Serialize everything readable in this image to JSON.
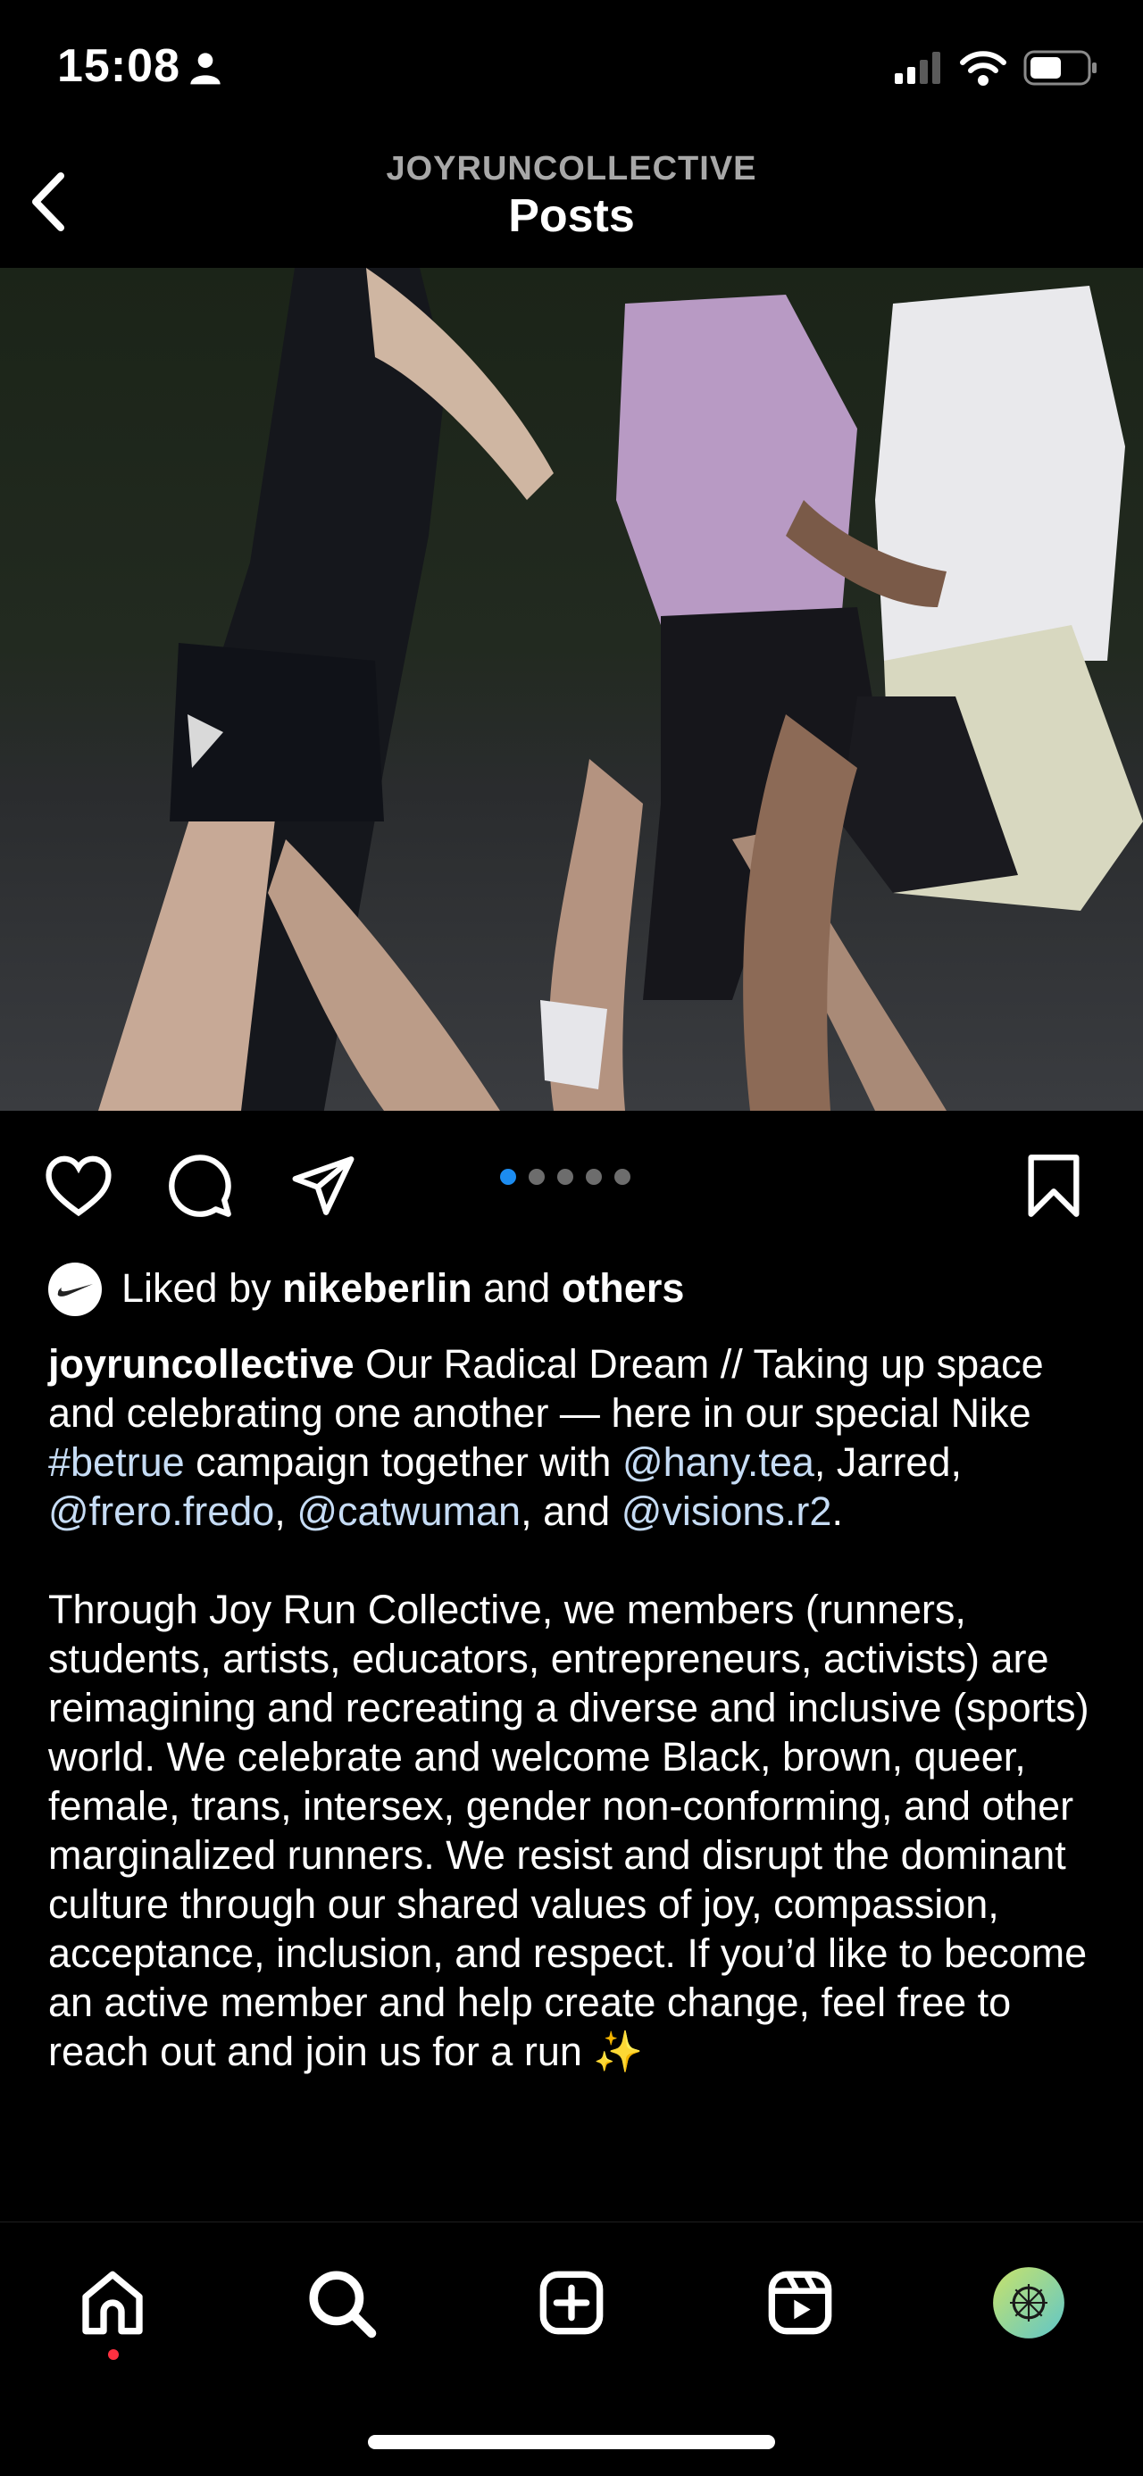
{
  "status_bar": {
    "time": "15:08"
  },
  "header": {
    "account": "JOYRUNCOLLECTIVE",
    "title": "Posts"
  },
  "post": {
    "carousel": {
      "count": 5,
      "active_index": 0
    },
    "liked_by": {
      "prefix": "Liked by",
      "user": "nikeberlin",
      "joiner": "and",
      "others": "others"
    },
    "caption": {
      "username": "joyruncollective",
      "t1": "Our Radical Dream // Taking up space and celebrating one another — here in our special Nike",
      "hashtag": "#betrue",
      "t2": "campaign together with",
      "m1": "@hany.tea",
      "t3": ", Jarred,",
      "m2": "@frero.fredo",
      "t4": ",",
      "m3": "@catwuman",
      "t5": ", and",
      "m4": "@visions.r2",
      "t6": ".",
      "paragraph2": "Through Joy Run Collective, we members (runners, students, artists, educators, entrepreneurs, activists) are reimagining and recreating a diverse and inclusive (sports) world. We celebrate and welcome Black, brown, queer, female, trans, intersex, gender non-conforming, and other marginalized runners. We resist and disrupt the dominant culture through our shared values of joy, compassion, acceptance, inclusion, and respect. If you’d like to become an active member and help create change, feel free to reach out and join us for a run ✨"
    }
  },
  "colors": {
    "link": "#c6dcf5",
    "dot_active": "#1c8cf0",
    "notification": "#ff3040"
  },
  "icons": [
    "person-icon",
    "signal-icon",
    "wifi-icon",
    "battery-icon",
    "back-chevron-icon",
    "heart-icon",
    "comment-icon",
    "share-icon",
    "bookmark-icon",
    "nike-swoosh-icon",
    "home-icon",
    "search-icon",
    "create-icon",
    "reels-icon",
    "profile-avatar-icon"
  ]
}
